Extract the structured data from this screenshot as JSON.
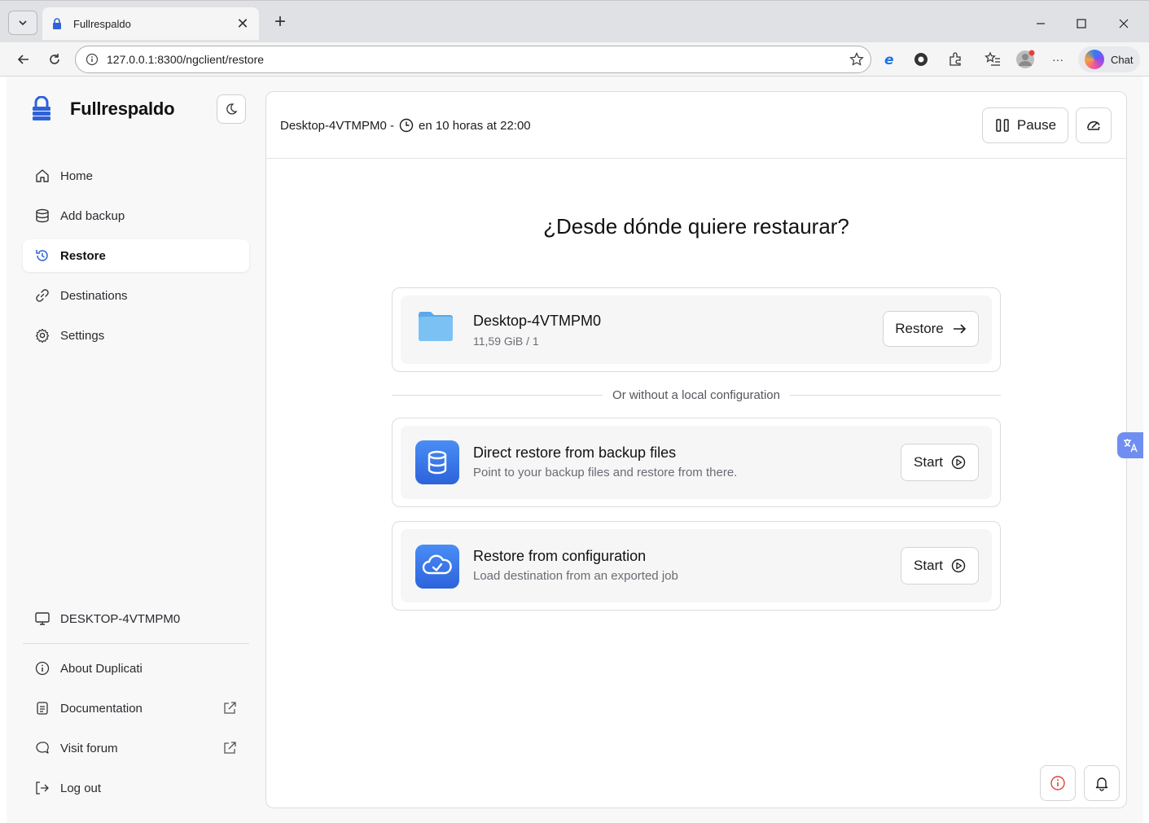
{
  "browser": {
    "tab_title": "Fullrespaldo",
    "tab_close": "✕",
    "new_tab": "+",
    "url": "127.0.0.1:8300/ngclient/restore",
    "chat_label": "Chat",
    "more": "···"
  },
  "sidebar": {
    "brand": "Fullrespaldo",
    "items": [
      {
        "label": "Home",
        "icon": "home-icon"
      },
      {
        "label": "Add backup",
        "icon": "database-icon"
      },
      {
        "label": "Restore",
        "icon": "history-icon",
        "active": true
      },
      {
        "label": "Destinations",
        "icon": "link-icon"
      },
      {
        "label": "Settings",
        "icon": "gear-icon"
      }
    ],
    "machine": "DESKTOP-4VTMPM0",
    "footer": [
      {
        "label": "About Duplicati",
        "icon": "info-icon"
      },
      {
        "label": "Documentation",
        "icon": "document-icon"
      },
      {
        "label": "Visit forum",
        "icon": "chat-icon"
      },
      {
        "label": "Log out",
        "icon": "logout-icon"
      }
    ]
  },
  "topbar": {
    "schedule_prefix": "Desktop-4VTMPM0 -",
    "schedule_time": "en 10 horas at 22:00",
    "pause_label": "Pause"
  },
  "main": {
    "heading": "¿Desde dónde quiere restaurar?",
    "backup_card": {
      "title": "Desktop-4VTMPM0",
      "subtitle": "11,59 GiB / 1",
      "button": "Restore"
    },
    "separator": "Or without a local configuration",
    "direct_card": {
      "title": "Direct restore from backup files",
      "subtitle": "Point to your backup files and restore from there.",
      "button": "Start"
    },
    "config_card": {
      "title": "Restore from configuration",
      "subtitle": "Load destination from an exported job",
      "button": "Start"
    }
  },
  "colors": {
    "accent_blue": "#3b7df0",
    "sidebar_bg": "#f8f8f9",
    "alert_red": "#e0433a"
  }
}
